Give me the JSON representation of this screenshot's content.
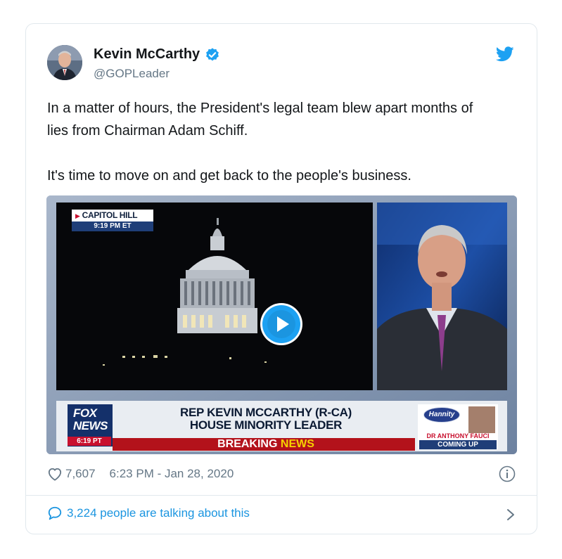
{
  "author": {
    "name": "Kevin McCarthy",
    "handle": "@GOPLeader"
  },
  "tweet": {
    "paragraph1": "In a matter of hours, the President's legal team blew apart months of lies from Chairman Adam Schiff.",
    "paragraph2": "It's time to move on and get back to the people's business."
  },
  "video": {
    "location_bug": "CAPITOL HILL",
    "location_time": "9:19 PM ET",
    "chyron_line1": "REP KEVIN MCCARTHY (R-CA)",
    "chyron_line2": "HOUSE MINORITY LEADER",
    "band_white": "BREAKING",
    "band_yellow": "NEWS",
    "network_line1": "FOX",
    "network_line2": "NEWS",
    "network_time": "6:19 PT",
    "promo_show": "Hannity",
    "promo_guest": "DR ANTHONY FAUCI",
    "promo_status": "COMING UP"
  },
  "meta": {
    "likes": "7,607",
    "timestamp": "6:23 PM - Jan 28, 2020"
  },
  "footer": {
    "talking_label": "3,224 people are talking about this"
  },
  "colors": {
    "twitter_blue": "#1da1f2",
    "link_blue": "#1b95e0",
    "secondary_text": "#657786",
    "fox_red": "#c8102e",
    "fox_blue": "#1f3e78"
  },
  "icons": [
    "verified-icon",
    "twitter-bird-icon",
    "play-icon",
    "heart-icon",
    "info-icon",
    "speech-bubble-icon",
    "chevron-right-icon"
  ]
}
